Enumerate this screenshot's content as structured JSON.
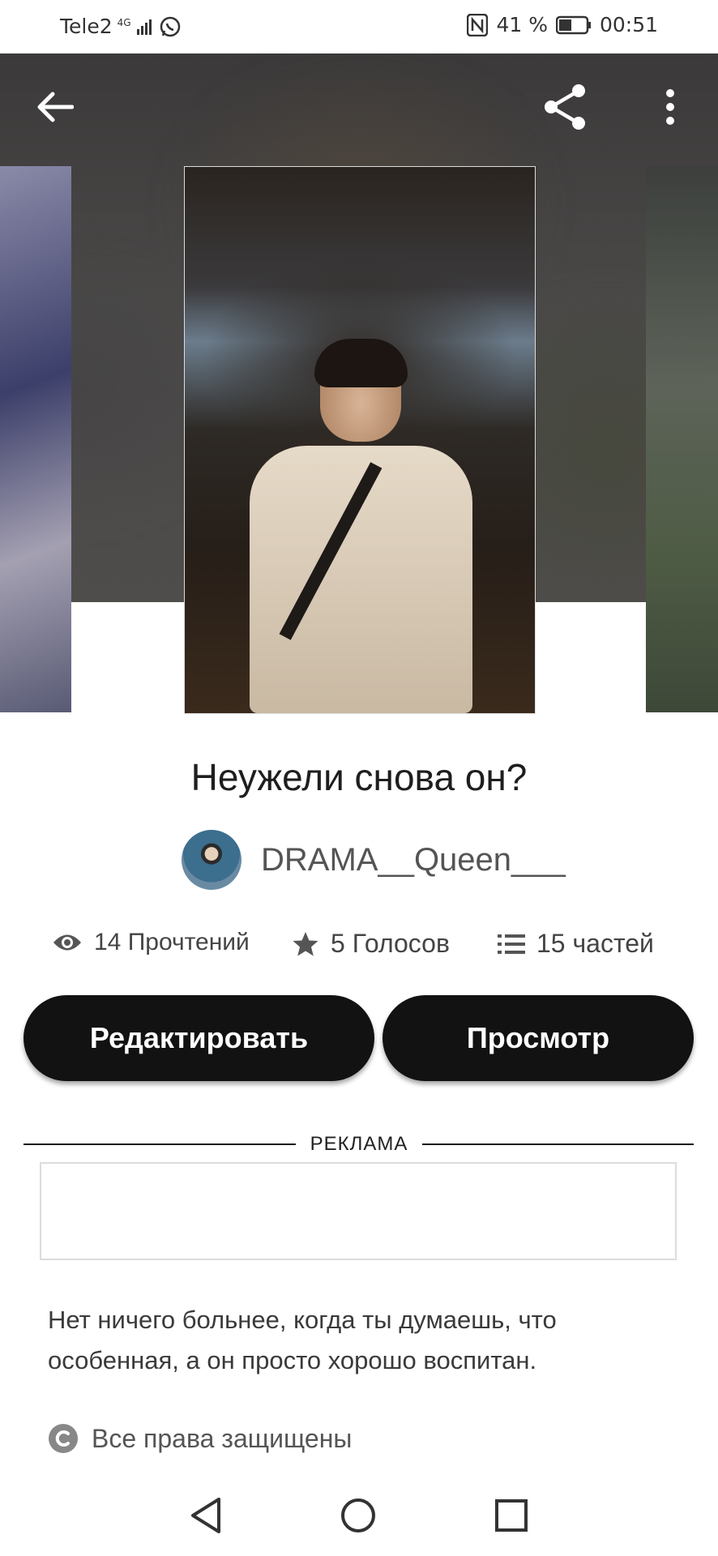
{
  "status_bar": {
    "carrier": "Tele2",
    "network": "4G",
    "battery_percent": "41 %",
    "time": "00:51"
  },
  "icons": {
    "back": "arrow-left-icon",
    "share": "share-icon",
    "more": "more-vertical-icon"
  },
  "story": {
    "title": "Неужели снова он?",
    "author": "DRAMA__Queen___",
    "stats": {
      "reads": "14 Прочтений",
      "votes": "5 Голосов",
      "parts": "15 частей"
    },
    "description": "Нет ничего больнее, когда ты думаешь, что особенная, а он просто хорошо воспитан.",
    "rights": "Все права защищены"
  },
  "actions": {
    "edit_label": "Редактировать",
    "view_label": "Просмотр"
  },
  "ad": {
    "label": "РЕКЛАМА"
  },
  "colors": {
    "button_bg": "#121212",
    "button_text": "#ffffff",
    "hero_bg": "#4a4948"
  }
}
